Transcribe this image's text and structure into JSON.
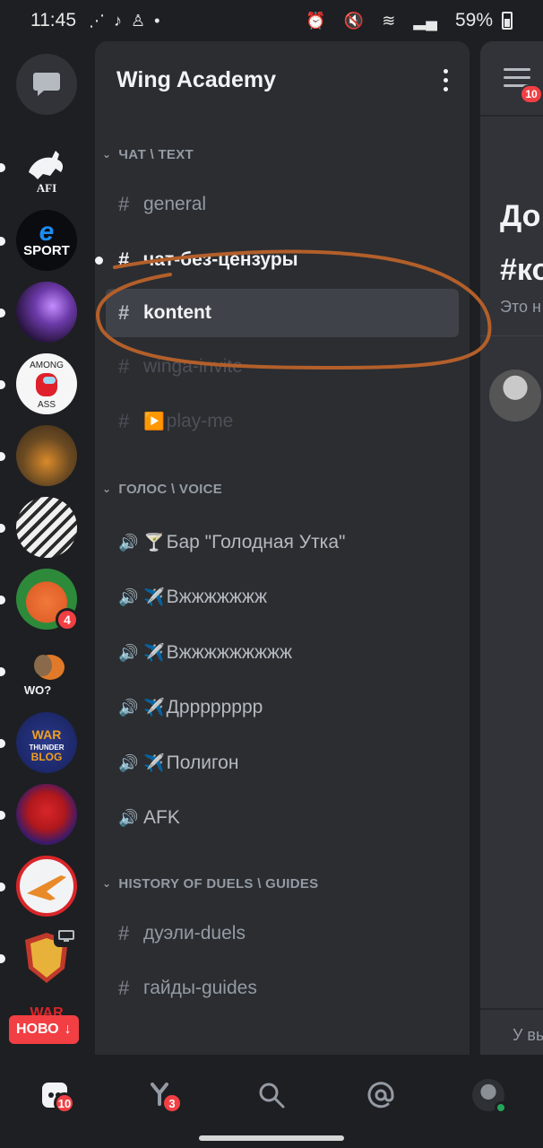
{
  "status_bar": {
    "time": "11:45",
    "battery": "59%"
  },
  "server_rail": {
    "servers": [
      {
        "name": "AFI",
        "label": "AFI",
        "unread": true
      },
      {
        "name": "e-sport",
        "label": "SPORT",
        "unread": true
      },
      {
        "name": "nebula",
        "label": "",
        "unread": true
      },
      {
        "name": "among-ass",
        "label": "AMONG ASS",
        "unread": true
      },
      {
        "name": "pumpkin-room",
        "label": "",
        "unread": true
      },
      {
        "name": "anime-manga",
        "label": "",
        "unread": true
      },
      {
        "name": "orange-guy",
        "label": "",
        "unread": true,
        "badge": "4"
      },
      {
        "name": "wtf-bird",
        "label": "WO?",
        "unread": true
      },
      {
        "name": "war-thunder-blog",
        "label": "WAR THUNDER BLOG",
        "unread": true
      },
      {
        "name": "knuckles",
        "label": "",
        "unread": true
      },
      {
        "name": "jet-circle",
        "label": "",
        "unread": true
      },
      {
        "name": "shield-crest",
        "label": "",
        "unread": true
      },
      {
        "name": "war-diskord",
        "label": "WAR DISKORD",
        "unread": false
      }
    ],
    "new_pill": "НОВО"
  },
  "guild": {
    "name": "Wing Academy"
  },
  "categories": [
    {
      "label": "ЧАТ \\ TEXT"
    },
    {
      "label": "ГОЛОС \\ VOICE"
    },
    {
      "label": "HISTORY OF DUELS \\ GUIDES"
    }
  ],
  "channels": {
    "text": [
      {
        "name": "general"
      },
      {
        "name": "чат-без-цензуры"
      },
      {
        "name": "kontent"
      },
      {
        "name": "winga-invite"
      },
      {
        "name": "play-me",
        "emoji": "▶️"
      }
    ],
    "voice": [
      {
        "name": "Бар \"Голодная Утка\"",
        "emoji": "🍸"
      },
      {
        "name": "Вжжжжжжж",
        "emoji": "✈️"
      },
      {
        "name": "Вжжжжжжжжж",
        "emoji": "✈️"
      },
      {
        "name": "Дрррррррр",
        "emoji": "✈️"
      },
      {
        "name": "Полигон",
        "emoji": "✈️"
      },
      {
        "name": "AFK",
        "emoji": ""
      }
    ],
    "guides": [
      {
        "name": "дуэли-duels"
      },
      {
        "name": "гайды-guides"
      }
    ]
  },
  "peek": {
    "menu_badge": "10",
    "title_line1": "До",
    "title_line2": "#ко",
    "subtitle": "Это н",
    "input_hint": "У вы"
  },
  "bottom_nav": {
    "home_badge": "10",
    "friends_badge": "3"
  },
  "colors": {
    "background": "#1e1f22",
    "panel": "#2b2d31",
    "selected": "#404249",
    "badge": "#f23f43",
    "annotation": "#b35f2a"
  }
}
